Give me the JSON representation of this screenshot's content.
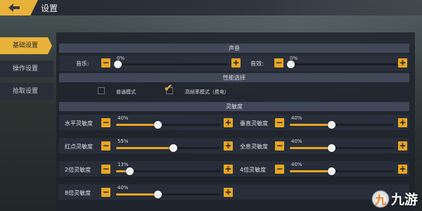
{
  "title": "设置",
  "nav": {
    "items": [
      {
        "label": "基础设置",
        "active": true
      },
      {
        "label": "操作设置",
        "active": false
      },
      {
        "label": "拾取设置",
        "active": false
      }
    ]
  },
  "sections": {
    "sound": "声音",
    "performance": "性能选择",
    "sensitivity": "灵敏度"
  },
  "sound": {
    "music": {
      "label": "音乐:",
      "value": "0%",
      "fraction": 0.0
    },
    "sfx": {
      "label": "音效:",
      "value": "0%",
      "fraction": 0.0
    }
  },
  "performance": {
    "normal": {
      "label": "普通模式",
      "checked": false
    },
    "high": {
      "label": "高帧率模式（费电）",
      "checked": true
    }
  },
  "sensitivity": {
    "horizontal": {
      "label": "水平灵敏度",
      "value": "40%",
      "fraction": 0.4
    },
    "vertical": {
      "label": "垂直灵敏度",
      "value": "40%",
      "fraction": 0.4
    },
    "red_dot": {
      "label": "红点灵敏度",
      "value": "55%",
      "fraction": 0.55
    },
    "holo": {
      "label": "全息灵敏度",
      "value": "40%",
      "fraction": 0.4
    },
    "scope2x": {
      "label": "2倍灵敏度",
      "value": "13%",
      "fraction": 0.13
    },
    "scope4x": {
      "label": "4倍灵敏度",
      "value": "40%",
      "fraction": 0.4
    },
    "scope8x": {
      "label": "8倍灵敏度",
      "value": "40%",
      "fraction": 0.4
    }
  },
  "controls": {
    "minus": "−",
    "plus": "+"
  },
  "watermark": {
    "text": "九游",
    "logo": "九"
  },
  "colors": {
    "accent": "#e8a622"
  }
}
